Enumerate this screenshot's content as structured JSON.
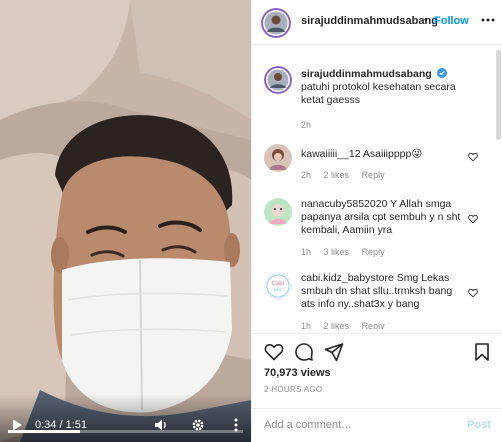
{
  "video": {
    "time": "0:34 / 1:51",
    "progress_fraction": 0.306
  },
  "header": {
    "username": "sirajuddinmahmudsabang",
    "dot": "•",
    "follow_label": "Follow"
  },
  "caption": {
    "author": "sirajuddinmahmudsabang",
    "text": "patuhi protokol kesehatan secara ketat gaesss",
    "age": "2h"
  },
  "comments": [
    {
      "author": "kawaiiiii__12",
      "text": "Asaiiipppp",
      "emoji": "😜",
      "age": "2h",
      "likes": "2 likes",
      "reply": "Reply"
    },
    {
      "author": "nanacuby5852020",
      "text": "Y Allah smga papanya arsila cpt sembuh y n sht kembali, Aamiin yra",
      "age": "1h",
      "likes": "3 likes",
      "reply": "Reply"
    },
    {
      "author": "cabi.kidz_babystore",
      "text": "Smg Lekas smbuh dn shat sllu..trmksh bang ats info ny..shat3x y bang",
      "age": "1h",
      "likes": "2 likes",
      "reply": "Reply"
    }
  ],
  "stats": {
    "views": "70,973 views",
    "posted": "2 HOURS AGO"
  },
  "add_comment": {
    "placeholder": "Add a comment…",
    "post_label": "Post"
  },
  "colors": {
    "accent": "#0095f6",
    "verified": "#3897f0",
    "muted": "#8e8e8e"
  },
  "icons": [
    "play-icon",
    "volume-icon",
    "settings-icon",
    "more-vertical-icon",
    "more-horizontal-icon",
    "verified-icon",
    "heart-icon",
    "comment-icon",
    "share-icon",
    "bookmark-icon"
  ]
}
